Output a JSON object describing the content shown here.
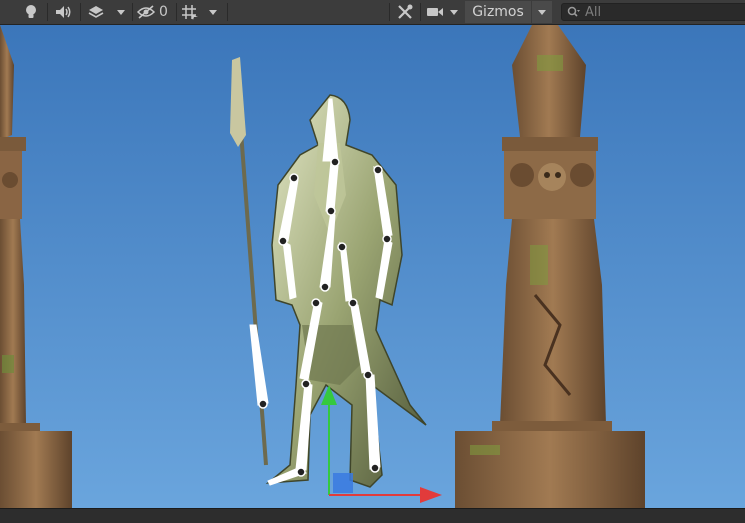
{
  "toolbar": {
    "lighting_icon": "lightbulb-icon",
    "audio_icon": "speaker-icon",
    "effects_icon": "layers-icon",
    "visibility_icon": "eye-slash-icon",
    "visibility_count": "0",
    "grid_icon": "grid-snap-icon",
    "tools_icon": "wrench-icon",
    "camera_icon": "camera-icon",
    "gizmos_label": "Gizmos",
    "search_icon": "search-icon",
    "search_placeholder": "All"
  },
  "scene": {
    "sky_color_top": "#3b76ba",
    "sky_color_bottom": "#6aa5dd",
    "bone_color": "#ffffff",
    "axis_x_color": "#e23b3b",
    "axis_y_color": "#35c93f",
    "axis_center_color": "#3a7ae0"
  }
}
